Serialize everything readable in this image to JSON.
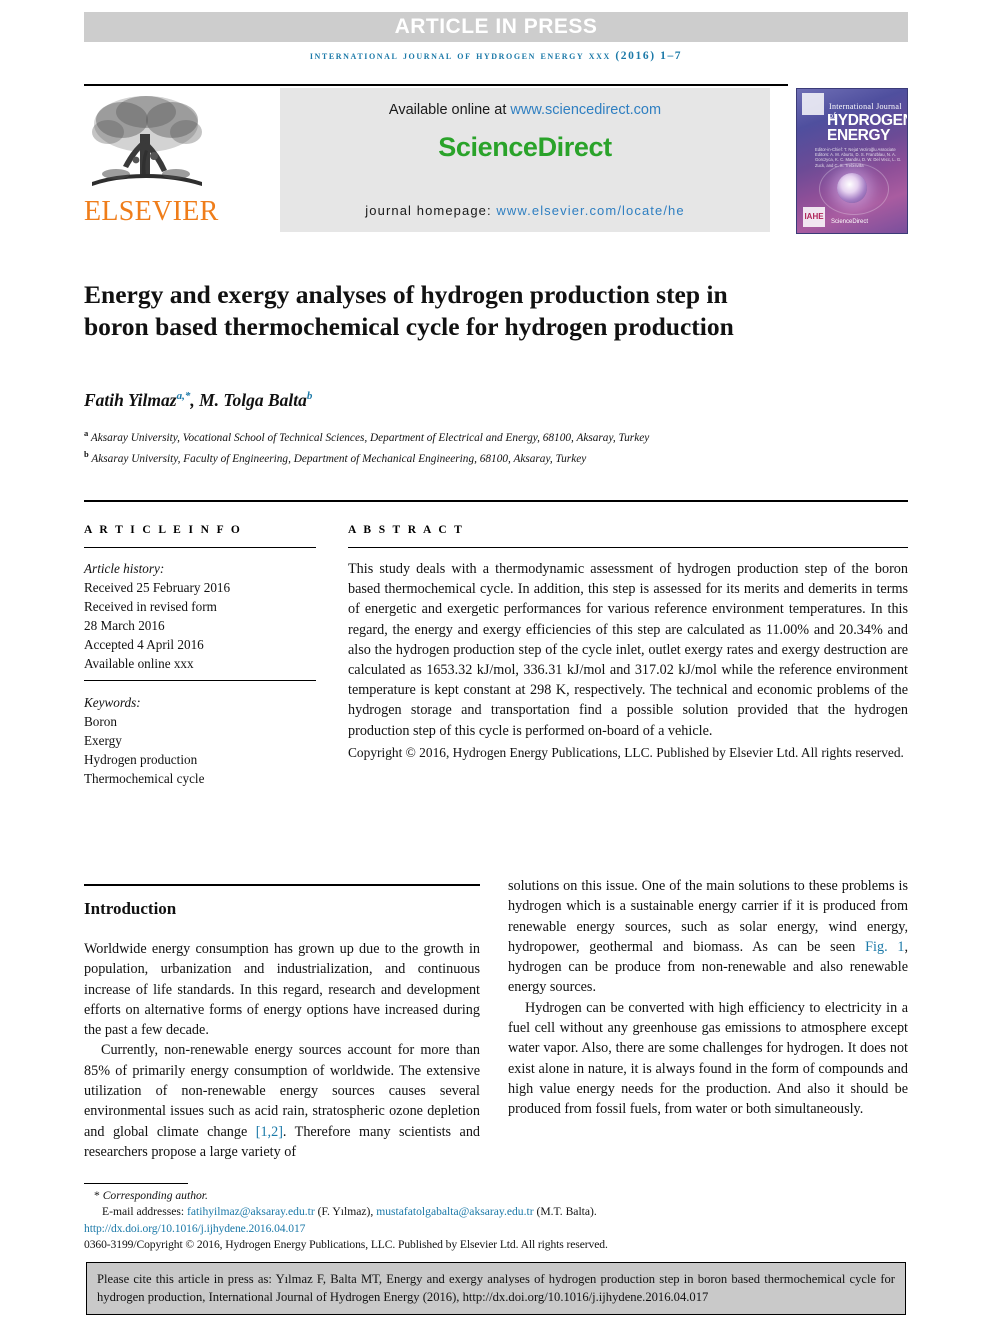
{
  "banner": {
    "text": "ARTICLE IN PRESS"
  },
  "journal_line": {
    "text": "international journal of hydrogen energy xxx (2016) 1–7",
    "color": "#1b79a8"
  },
  "masthead": {
    "publisher_name": "ELSEVIER",
    "publisher_color": "#ef7d1a",
    "available_prefix": "Available online at ",
    "available_link": "www.sciencedirect.com",
    "brand_science": "Science",
    "brand_direct": "Direct",
    "brand_color": "#2aa32a",
    "homepage_prefix": "journal homepage: ",
    "homepage_link": "www.elsevier.com/locate/he",
    "cover": {
      "line_small": "International Journal of",
      "line_big_1": "HYDROGEN",
      "line_big_2": "ENERGY",
      "editors": "Editor-in-Chief:  T. Nejat Veziroğlu     Associate Editors:  A. M. Aburto, D. S. Franzblau, N. A. Gorczyca, K. C. Mandru, D. W. Del Vecc, L. G. Zuck, and C. S. Trebisvilla",
      "badge": "IAHE",
      "sciencedirect": "ScienceDirect"
    }
  },
  "article": {
    "title": "Energy and exergy analyses of hydrogen production step in boron based thermochemical cycle for hydrogen production",
    "authors_plain": "Fatih Yilmaz a,*, M. Tolga Balta b",
    "author_1": "Fatih Yilmaz",
    "author_1_sup": "a,",
    "author_1_star": "*",
    "author_2": "M. Tolga Balta",
    "author_2_sup": "b",
    "affiliation_a_marker": "a",
    "affiliation_a": "Aksaray University, Vocational School of Technical Sciences, Department of Electrical and Energy, 68100, Aksaray, Turkey",
    "affiliation_b_marker": "b",
    "affiliation_b": "Aksaray University, Faculty of Engineering, Department of Mechanical Engineering, 68100, Aksaray, Turkey"
  },
  "article_info": {
    "label": "A R T I C L E   I N F O",
    "history_header": "Article history:",
    "received": "Received 25 February 2016",
    "revised_label": "Received in revised form",
    "revised_date": "28 March 2016",
    "accepted": "Accepted 4 April 2016",
    "available_online": "Available online xxx",
    "keywords_header": "Keywords:",
    "keywords": [
      "Boron",
      "Exergy",
      "Hydrogen production",
      "Thermochemical cycle"
    ]
  },
  "abstract": {
    "label": "A B S T R A C T",
    "body": "This study deals with a thermodynamic assessment of hydrogen production step of the boron based thermochemical cycle. In addition, this step is assessed for its merits and demerits in terms of energetic and exergetic performances for various reference environment temperatures. In this regard, the energy and exergy efficiencies of this step are calculated as 11.00% and 20.34% and also the hydrogen production step of the cycle inlet, outlet exergy rates and exergy destruction are calculated as 1653.32 kJ/mol, 336.31 kJ/mol and 317.02 kJ/mol while the reference environment temperature is kept constant at 298 K, respectively. The technical and economic problems of the hydrogen storage and transportation find a possible solution provided that the hydrogen production step of this cycle is performed on-board of a vehicle.",
    "copyright": "Copyright © 2016, Hydrogen Energy Publications, LLC. Published by Elsevier Ltd. All rights reserved."
  },
  "introduction": {
    "heading": "Introduction",
    "left_para_1": "Worldwide energy consumption has grown up due to the growth in population, urbanization and industrialization, and continuous increase of life standards. In this regard, research and development efforts on alternative forms of energy options have increased during the past a few decade.",
    "left_para_2_a": "Currently, non-renewable energy sources account for more than 85% of primarily energy consumption of worldwide. The extensive utilization of non-renewable energy sources causes several environmental issues such as acid rain, stratospheric ozone depletion and global climate change ",
    "left_para_2_cite": "[1,2]",
    "left_para_2_b": ". Therefore many scientists and researchers propose a large variety of",
    "right_para_1_a": "solutions on this issue. One of the main solutions to these problems is hydrogen which is a sustainable energy carrier if it is produced from renewable energy sources, such as solar energy, wind energy, hydropower, geothermal and biomass. As can be seen ",
    "right_para_1_cite": "Fig. 1",
    "right_para_1_b": ", hydrogen can be produce from non-renewable and also renewable energy sources.",
    "right_para_2": "Hydrogen can be converted with high efficiency to electricity in a fuel cell without any greenhouse gas emissions to atmosphere except water vapor. Also, there are some challenges for hydrogen. It does not exist alone in nature, it is always found in the form of compounds and high value energy needs for the production. And also it should be produced from fossil fuels, from water or both simultaneously."
  },
  "footnotes": {
    "corresponding_star": "*",
    "corresponding_text": "Corresponding author.",
    "email_label": "E-mail addresses:",
    "email_1": "fatihyilmaz@aksaray.edu.tr",
    "email_1_owner": "(F. Yılmaz),",
    "email_2": "mustafatolgabalta@aksaray.edu.tr",
    "email_2_owner": "(M.T. Balta).",
    "doi": "http://dx.doi.org/10.1016/j.ijhydene.2016.04.017",
    "issn_line": "0360-3199/Copyright © 2016, Hydrogen Energy Publications, LLC. Published by Elsevier Ltd. All rights reserved."
  },
  "cite_box": {
    "text": "Please cite this article in press as: Yılmaz F, Balta MT, Energy and exergy analyses of hydrogen production step in boron based thermochemical cycle for hydrogen production, International Journal of Hydrogen Energy (2016), http://dx.doi.org/10.1016/j.ijhydene.2016.04.017"
  }
}
